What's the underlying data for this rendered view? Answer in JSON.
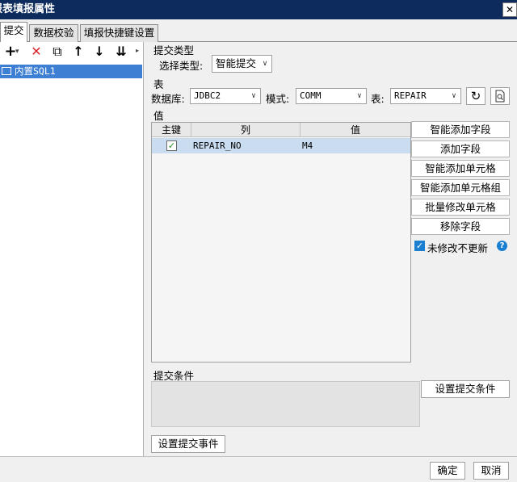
{
  "window": {
    "title": "报表填报属性",
    "close_glyph": "✕"
  },
  "tabs": [
    {
      "label": "提交"
    },
    {
      "label": "数据校验"
    },
    {
      "label": "填报快捷键设置"
    }
  ],
  "left_toolbar": {
    "add": "+",
    "add_dropdown": "▾",
    "delete": "✕",
    "copy": "⧉",
    "up": "↑",
    "down": "↓",
    "sort": "⇊"
  },
  "tree": {
    "items": [
      {
        "label": "内置SQL1"
      }
    ]
  },
  "submit_type": {
    "section_label": "提交类型",
    "select_label": "选择类型:",
    "select_value": "智能提交"
  },
  "table_section": {
    "section_label": "表",
    "db_label": "数据库:",
    "db_value": "JDBC2",
    "schema_label": "模式:",
    "schema_value": "COMM",
    "table_label": "表:",
    "table_value": "REPAIR"
  },
  "values_section": {
    "section_label": "值",
    "columns": [
      "主键",
      "列",
      "值"
    ],
    "rows": [
      {
        "key_checked": true,
        "column": "REPAIR_NO",
        "value": "M4"
      }
    ]
  },
  "side_buttons": {
    "smart_add_field": "智能添加字段",
    "add_field": "添加字段",
    "smart_add_cell": "智能添加单元格",
    "smart_add_cell_group": "智能添加单元格组",
    "batch_modify_cell": "批量修改单元格",
    "remove_field": "移除字段",
    "no_update_unmodified": "未修改不更新",
    "no_update_checked": true
  },
  "condition": {
    "section_label": "提交条件",
    "set_button": "设置提交条件"
  },
  "event_button": "设置提交事件",
  "footer": {
    "ok": "确定",
    "cancel": "取消"
  },
  "colors": {
    "titlebar": "#0d2b5c",
    "selection": "#3d7fd3",
    "row_selected": "#c9dcf0",
    "delete_red": "#d9262c"
  }
}
